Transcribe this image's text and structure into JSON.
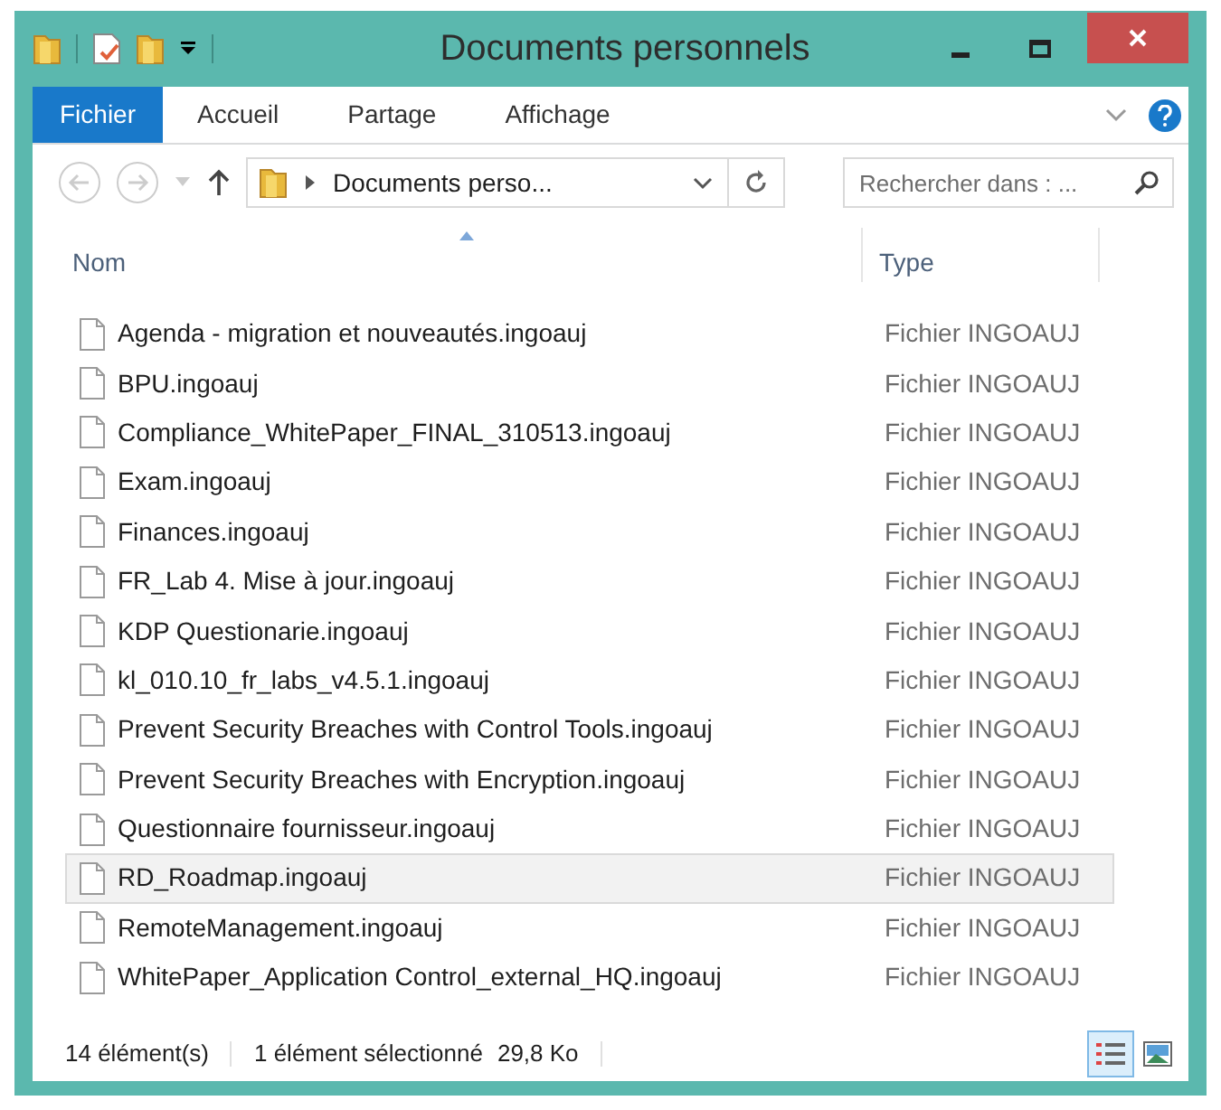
{
  "window": {
    "title": "Documents personnels"
  },
  "ribbon_tabs": [
    {
      "label": "Fichier",
      "selected": true
    },
    {
      "label": "Accueil",
      "selected": false
    },
    {
      "label": "Partage",
      "selected": false
    },
    {
      "label": "Affichage",
      "selected": false
    }
  ],
  "address": {
    "path": "Documents perso..."
  },
  "search": {
    "placeholder": "Rechercher dans : ..."
  },
  "columns": [
    "Nom",
    "Type"
  ],
  "files": [
    {
      "name": "Agenda - migration et nouveautés.ingoauj",
      "type": "Fichier INGOAUJ",
      "selected": false
    },
    {
      "name": "BPU.ingoauj",
      "type": "Fichier INGOAUJ",
      "selected": false
    },
    {
      "name": "Compliance_WhitePaper_FINAL_310513.ingoauj",
      "type": "Fichier INGOAUJ",
      "selected": false
    },
    {
      "name": "Exam.ingoauj",
      "type": "Fichier INGOAUJ",
      "selected": false
    },
    {
      "name": "Finances.ingoauj",
      "type": "Fichier INGOAUJ",
      "selected": false
    },
    {
      "name": "FR_Lab 4. Mise à jour.ingoauj",
      "type": "Fichier INGOAUJ",
      "selected": false
    },
    {
      "name": "KDP Questionarie.ingoauj",
      "type": "Fichier INGOAUJ",
      "selected": false
    },
    {
      "name": "kl_010.10_fr_labs_v4.5.1.ingoauj",
      "type": "Fichier INGOAUJ",
      "selected": false
    },
    {
      "name": "Prevent Security Breaches with Control Tools.ingoauj",
      "type": "Fichier INGOAUJ",
      "selected": false
    },
    {
      "name": "Prevent Security Breaches with Encryption.ingoauj",
      "type": "Fichier INGOAUJ",
      "selected": false
    },
    {
      "name": "Questionnaire fournisseur.ingoauj",
      "type": "Fichier INGOAUJ",
      "selected": false
    },
    {
      "name": "RD_Roadmap.ingoauj",
      "type": "Fichier INGOAUJ",
      "selected": true
    },
    {
      "name": "RemoteManagement.ingoauj",
      "type": "Fichier INGOAUJ",
      "selected": false
    },
    {
      "name": "WhitePaper_Application Control_external_HQ.ingoauj",
      "type": "Fichier INGOAUJ",
      "selected": false
    }
  ],
  "status_bar": {
    "count": "14 élément(s)",
    "selection": "1 élément sélectionné",
    "size": "29,8 Ko"
  },
  "views": [
    {
      "selected": true
    },
    {
      "selected": false
    }
  ]
}
